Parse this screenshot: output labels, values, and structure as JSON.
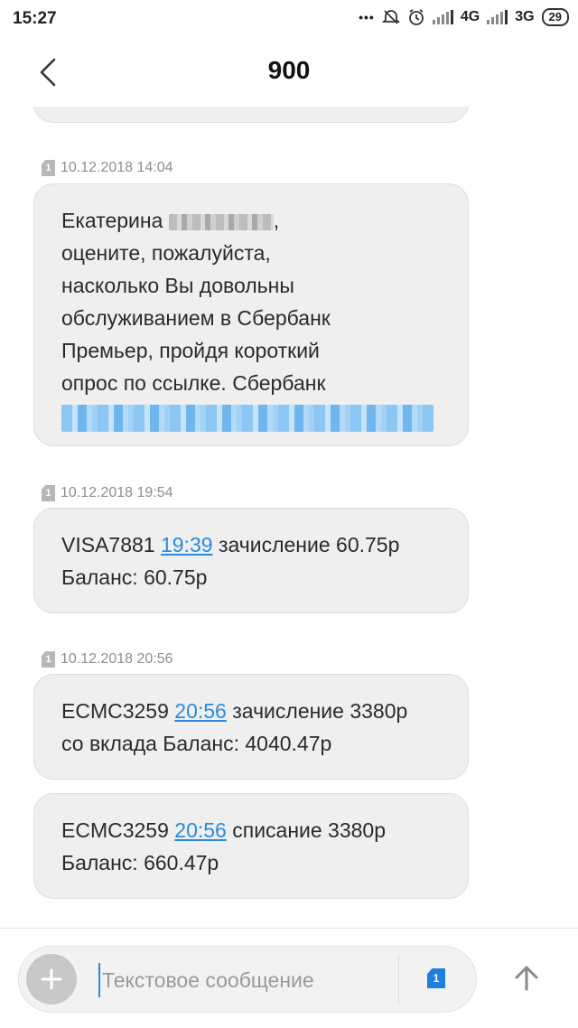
{
  "status_bar": {
    "time": "15:27",
    "network_1": "4G",
    "network_2": "3G",
    "battery": "29"
  },
  "header": {
    "title": "900",
    "back_icon": "chevron-left-icon"
  },
  "messages": [
    {
      "sim": "1",
      "timestamp": "10.12.2018 14:04",
      "name": "Екатерина",
      "text_after": ",",
      "lines": [
        "оцените, пожалуйста,",
        "насколько Вы довольны",
        "обслуживанием в Сбербанк",
        "Премьер, пройдя короткий",
        "опрос по ссылке. Сбербанк"
      ]
    },
    {
      "sim": "1",
      "timestamp": "10.12.2018 19:54",
      "prefix": "VISA7881",
      "time_link": "19:39",
      "rest": "зачисление 60.75р",
      "line2": "Баланс: 60.75р"
    },
    {
      "sim": "1",
      "timestamp": "10.12.2018 20:56",
      "prefix": "ECMC3259",
      "time_link": "20:56",
      "rest": "зачисление 3380р",
      "line2": "со вклада Баланс: 4040.47р"
    },
    {
      "prefix": "ECMC3259",
      "time_link": "20:56",
      "rest": "списание 3380р",
      "line2": "Баланс: 660.47р"
    }
  ],
  "composer": {
    "placeholder": "Текстовое сообщение",
    "sim_label": "1",
    "add_icon": "plus-icon",
    "send_icon": "arrow-up-icon"
  },
  "colors": {
    "link": "#2a8ae2",
    "bubble": "#efefef",
    "sim_active": "#1f7fe0"
  }
}
